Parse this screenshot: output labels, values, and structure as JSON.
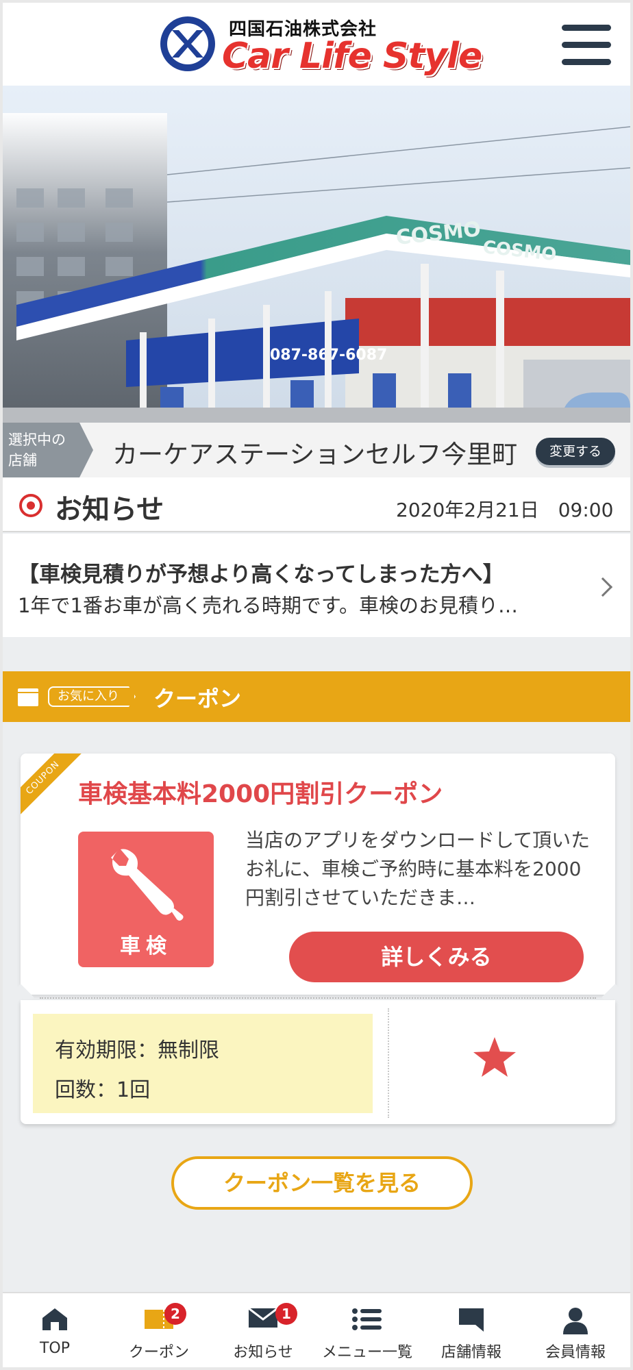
{
  "header": {
    "company": "四国石油株式会社",
    "brand": "Car Life Style"
  },
  "store": {
    "tag_line1": "選択中の",
    "tag_line2": "店舗",
    "name": "カーケアステーションセルフ今里町",
    "change_label": "変更する"
  },
  "news": {
    "title": "お知らせ",
    "date": "2020年2月21日　09:00",
    "item_title": "【車検見積りが予想より高くなってしまった方へ】",
    "item_sub": "1年で1番お車が高く売れる時期です。車検のお見積り…"
  },
  "coupon_section": {
    "fav_label": "お気に入り",
    "title": "クーポン"
  },
  "coupon": {
    "ribbon": "COUPON",
    "title": "車検基本料2000円割引クーポン",
    "icon_label": "車検",
    "icon": "wrench-icon",
    "description": "当店のアプリをダウンロードして頂いたお礼に、車検ご予約時に基本料を2000円割引させていただきま…",
    "detail_button": "詳しくみる",
    "validity": "有効期限：無制限",
    "count": "回数：1回",
    "favorite_icon": "star-icon"
  },
  "list_button": "クーポン一覧を見る",
  "tabs": [
    {
      "label": "TOP",
      "icon": "home-icon"
    },
    {
      "label": "クーポン",
      "icon": "coupon-icon",
      "badge": "2"
    },
    {
      "label": "お知らせ",
      "icon": "mail-icon",
      "badge": "1"
    },
    {
      "label": "メニュー一覧",
      "icon": "list-icon"
    },
    {
      "label": "店舗情報",
      "icon": "store-icon"
    },
    {
      "label": "会員情報",
      "icon": "user-icon"
    }
  ],
  "colors": {
    "accent_orange": "#e8a615",
    "coupon_red": "#e24e4e",
    "navy": "#2c3a48",
    "badge_red": "#d8232a"
  }
}
